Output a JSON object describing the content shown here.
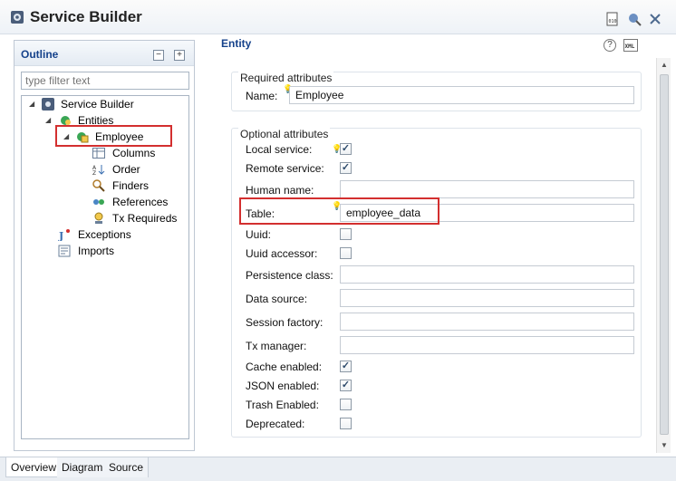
{
  "window": {
    "title": "Service Builder"
  },
  "outline": {
    "title": "Outline",
    "filter_placeholder": "type filter text",
    "tree": {
      "root": "Service Builder",
      "entities": "Entities",
      "employee": "Employee",
      "columns": "Columns",
      "order": "Order",
      "finders": "Finders",
      "references": "References",
      "tx_requireds": "Tx Requireds",
      "exceptions": "Exceptions",
      "imports": "Imports"
    }
  },
  "entity": {
    "title": "Entity",
    "required": {
      "title": "Required attributes",
      "name_label": "Name:",
      "name_value": "Employee"
    },
    "optional": {
      "title": "Optional attributes",
      "local_service_label": "Local service:",
      "local_service": true,
      "remote_service_label": "Remote service:",
      "remote_service": true,
      "human_name_label": "Human name:",
      "human_name_value": "",
      "table_label": "Table:",
      "table_value": "employee_data",
      "uuid_label": "Uuid:",
      "uuid": false,
      "uuid_accessor_label": "Uuid accessor:",
      "uuid_accessor": false,
      "persistence_class_label": "Persistence class:",
      "persistence_class_value": "",
      "data_source_label": "Data source:",
      "data_source_value": "",
      "session_factory_label": "Session factory:",
      "session_factory_value": "",
      "tx_manager_label": "Tx manager:",
      "tx_manager_value": "",
      "cache_enabled_label": "Cache enabled:",
      "cache_enabled": true,
      "json_enabled_label": "JSON enabled:",
      "json_enabled": true,
      "trash_enabled_label": "Trash Enabled:",
      "trash_enabled": false,
      "deprecated_label": "Deprecated:",
      "deprecated": false
    }
  },
  "tabs": {
    "overview": "Overview",
    "diagram": "Diagram",
    "source": "Source"
  },
  "colors": {
    "highlight": "#d32f2f",
    "section_title": "#15428b"
  }
}
